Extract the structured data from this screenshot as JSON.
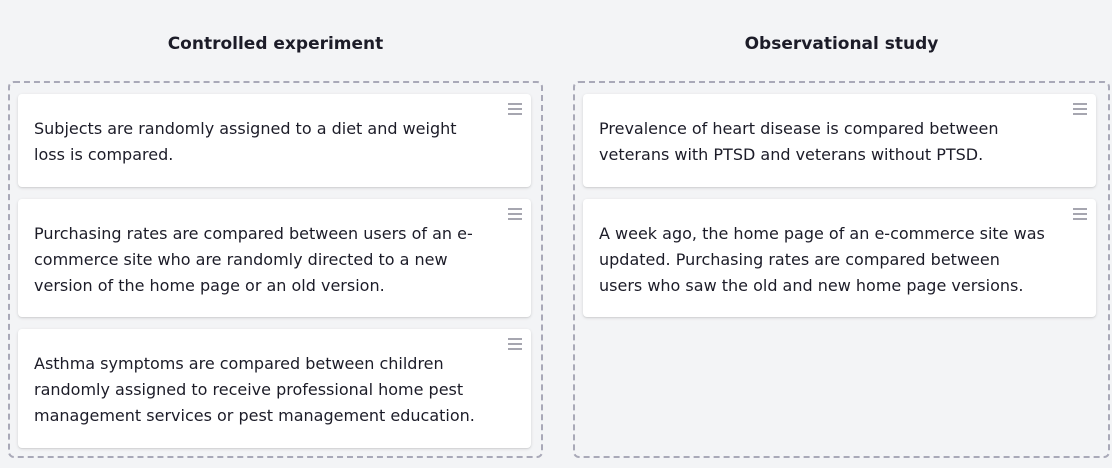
{
  "columns": {
    "left": {
      "title": "Controlled experiment",
      "cards": [
        "Subjects are randomly assigned to a diet and weight loss is compared.",
        "Purchasing rates are compared between users of an e-commerce site who are randomly directed to a new version of the home page or an old version.",
        "Asthma symptoms are compared between children randomly assigned to receive professional home pest management services or pest management education."
      ]
    },
    "right": {
      "title": "Observational study",
      "cards": [
        "Prevalence of heart disease is compared between veterans with PTSD and veterans without PTSD.",
        "A week ago, the home page of an e-commerce site was updated. Purchasing rates are compared between users who saw the old and new home page versions."
      ]
    }
  },
  "icons": {
    "drag_handle": "drag-handle-icon"
  }
}
